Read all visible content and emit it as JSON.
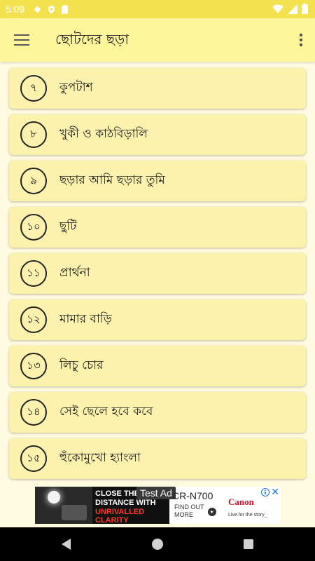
{
  "status_bar": {
    "time": "5:09",
    "left_icons": [
      "gear-icon",
      "shield-icon",
      "sd-card-icon"
    ],
    "right_icons": [
      "wifi-icon",
      "signal-icon",
      "battery-icon"
    ]
  },
  "app_bar": {
    "title": "ছোটদের ছড়া",
    "menu_icon": "menu-icon",
    "more_icon": "more-vert-icon",
    "background": "#fff59a"
  },
  "items": [
    {
      "number": "৭",
      "title": "কুপটাশ"
    },
    {
      "number": "৮",
      "title": "খুকী ও কাঠবিড়ালি"
    },
    {
      "number": "৯",
      "title": "ছড়ার আমি ছড়ার তুমি"
    },
    {
      "number": "১০",
      "title": "ছুটি"
    },
    {
      "number": "১১",
      "title": "প্রার্থনা"
    },
    {
      "number": "১২",
      "title": "মামার বাড়ি"
    },
    {
      "number": "১৩",
      "title": "লিচু চোর"
    },
    {
      "number": "১৪",
      "title": "সেই ছেলে হবে কবে"
    },
    {
      "number": "১৫",
      "title": "হুঁকোমুখো হ্যাংলা"
    }
  ],
  "ad": {
    "badge": "Test Ad",
    "headline_1": "CLOSE THE",
    "headline_2": "DISTANCE WITH",
    "headline_3": "UNRIVALLED CLARITY",
    "model": "CR-N700",
    "cta": "FIND OUT MORE",
    "brand": "Canon",
    "brand_tagline": "Live for the story_"
  },
  "nav_bar": {
    "back_icon": "back-triangle-icon",
    "home_icon": "home-circle-icon",
    "recents_icon": "recents-square-icon"
  },
  "colors": {
    "status_bar": "#f3e24f",
    "card": "#fdf2ad",
    "page": "#fffbe0"
  }
}
